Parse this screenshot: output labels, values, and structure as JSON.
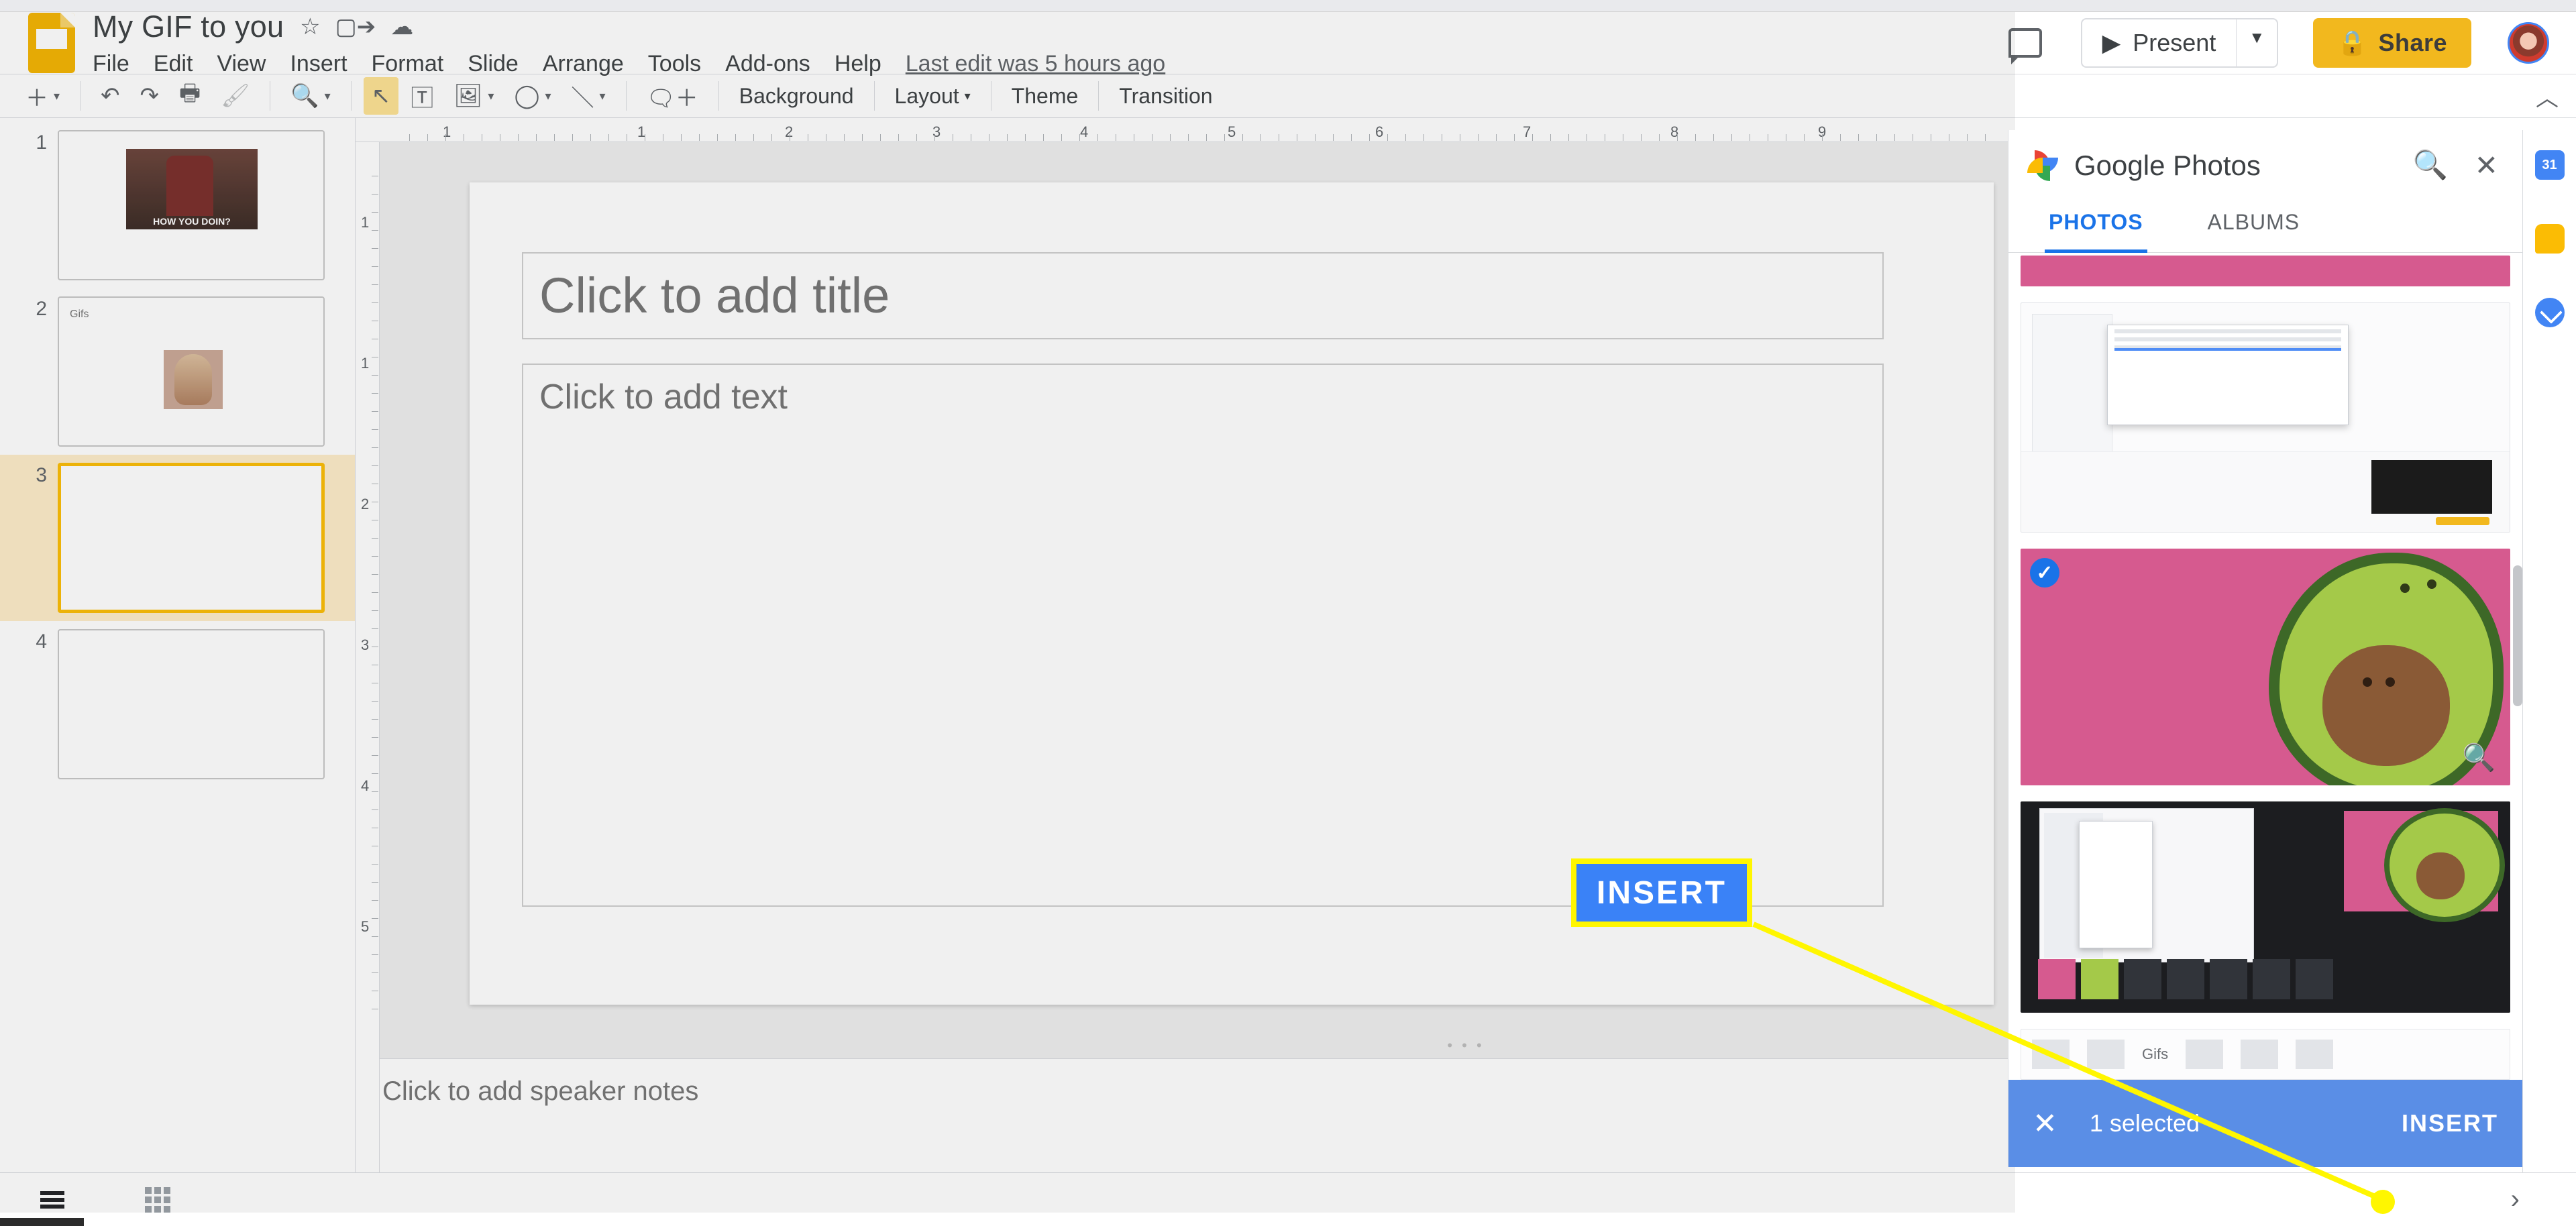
{
  "app": {
    "document_title": "My GIF to you",
    "last_edit": "Last edit was 5 hours ago"
  },
  "menus": {
    "file": "File",
    "edit": "Edit",
    "view": "View",
    "insert": "Insert",
    "format": "Format",
    "slide": "Slide",
    "arrange": "Arrange",
    "tools": "Tools",
    "addons": "Add-ons",
    "help": "Help"
  },
  "header_buttons": {
    "present": "Present",
    "share": "Share"
  },
  "toolbar": {
    "background": "Background",
    "layout": "Layout",
    "theme": "Theme",
    "transition": "Transition"
  },
  "filmstrip": {
    "items": [
      {
        "num": "1",
        "kind": "joey"
      },
      {
        "num": "2",
        "kind": "gifs",
        "title": "Gifs"
      },
      {
        "num": "3",
        "kind": "blank",
        "selected": true
      },
      {
        "num": "4",
        "kind": "blank"
      }
    ]
  },
  "canvas": {
    "title_placeholder": "Click to add title",
    "body_placeholder": "Click to add text",
    "speaker_notes_placeholder": "Click to add speaker notes"
  },
  "ruler_h_labels": [
    "1",
    "1",
    "2",
    "3",
    "4",
    "5",
    "6",
    "7",
    "8",
    "9"
  ],
  "ruler_v_labels": [
    "1",
    "1",
    "2",
    "3",
    "4",
    "5"
  ],
  "sidepanel": {
    "title": "Google Photos",
    "tabs": {
      "photos": "PHOTOS",
      "albums": "ALBUMS"
    },
    "active_tab": "photos"
  },
  "insert_bar": {
    "selection_text": "1 selected",
    "insert_label": "INSERT"
  },
  "annotation": {
    "insert_label": "INSERT"
  },
  "photo5_label": "Gifs",
  "colors": {
    "highlight": "#fff600",
    "blue_button": "#3a82f7",
    "blue_bar": "#5a8ee6",
    "share_yellow": "#f2b81e"
  }
}
